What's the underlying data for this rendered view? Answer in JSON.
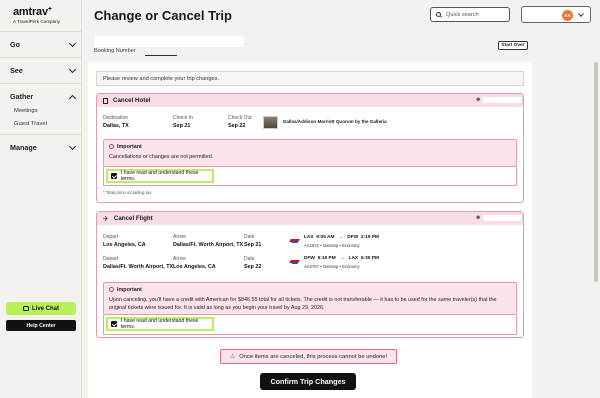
{
  "brand": {
    "name": "amtrav",
    "plus": "+",
    "tagline": "A TravelPerk Company"
  },
  "sidebar": {
    "items": [
      {
        "label": "Go"
      },
      {
        "label": "See"
      },
      {
        "label": "Gather"
      },
      {
        "label": "Manage"
      }
    ],
    "gather_sub": [
      {
        "label": "Meetings"
      },
      {
        "label": "Guest Travel"
      }
    ],
    "live_chat": "Live Chat",
    "help_center": "Help Center"
  },
  "header": {
    "title": "Change or Cancel Trip",
    "search_placeholder": "Quick search",
    "avatar_initials": "AA"
  },
  "booking": {
    "label": "Booking Number",
    "start_over": "Start Over"
  },
  "review_text": "Please review and complete your trip changes.",
  "hotel": {
    "title": "Cancel Hotel",
    "destination_label": "Destination",
    "destination": "Dallas, TX",
    "checkin_label": "Check In",
    "checkin": "Sep 21",
    "checkout_label": "Check Out",
    "checkout": "Sep 22",
    "hotel_name": "Dallas/Addison Marriott Quorum by the Galleria",
    "important_title": "Important",
    "important_text": "Cancellations or changes are not permitted.",
    "ack_text": "I have read and understand these terms.",
    "note": "* Total price including tax"
  },
  "flight": {
    "title": "Cancel Flight",
    "legs": [
      {
        "depart_label": "Depart",
        "depart": "Los Angeles, CA",
        "arrive_label": "Arrive",
        "arrive": "Dallas/Ft. Worth Airport, TX",
        "date_label": "Date",
        "date": "Sep 21",
        "from": "LAX",
        "from_time": "9:05 AM",
        "arrow": "→",
        "to": "DFW",
        "to_time": "2:19 PM",
        "flight_info": "AA1972  •  Nonstop  •  Economy"
      },
      {
        "depart_label": "Depart",
        "depart": "Dallas/Ft. Worth Airport, TX",
        "arrive_label": "Arrive",
        "arrive": "Los Angeles, CA",
        "date_label": "Date",
        "date": "Sep 22",
        "from": "DFW",
        "from_time": "5:19 PM",
        "arrow": "→",
        "to": "LAX",
        "to_time": "6:30 PM",
        "flight_info": "AA2767  •  Nonstop  •  Economy"
      }
    ],
    "important_title": "Important",
    "important_line1": "Upon canceling, you'll have a credit with American for $846.55 total for all tickets. The credit is not transferable — it has to be used for the same traveler(s) that the",
    "important_line2": "original tickets were issued for. It is valid as long as you begin your travel by Aug 29, 2026.",
    "ack_text": "I have read and understand these terms."
  },
  "warning": "Once items are canceled, this process cannot be undone!",
  "confirm_button": "Confirm Trip Changes",
  "colors": {
    "accent_green": "#b9f15b",
    "pink_border": "#e49ab0",
    "pink_bg": "#f9dde5",
    "avatar": "#e87a3d"
  }
}
